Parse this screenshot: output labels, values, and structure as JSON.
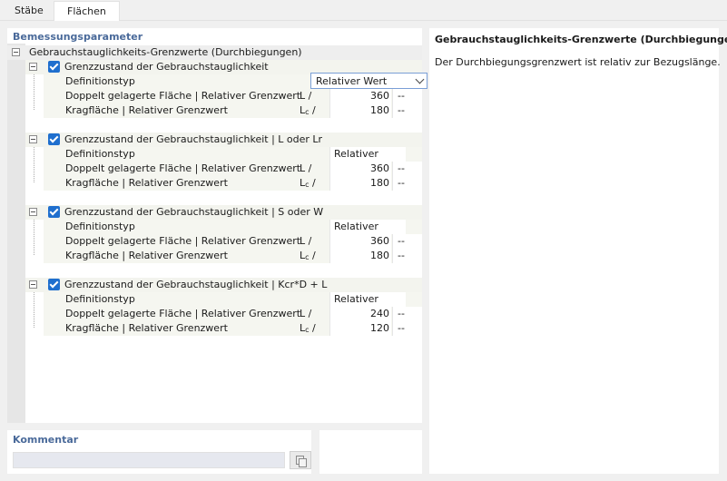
{
  "tabs": [
    {
      "label": "Stäbe",
      "active": false
    },
    {
      "label": "Flächen",
      "active": true
    }
  ],
  "params": {
    "section_title": "Bemessungsparameter",
    "root_label": "Gebrauchstauglichkeits-Grenzwerte (Durchbiegungen)",
    "groups": [
      {
        "label": "Grenzzustand der Gebrauchstauglichkeit",
        "checked": true,
        "definition_label": "Definitionstyp",
        "definition_value": "Relativer Wert",
        "definition_is_dropdown": true,
        "row1_label": "Doppelt gelagerte Fläche | Relativer Grenzwert",
        "row1_symbol": "L /",
        "row1_value": "360",
        "row1_unit": "--",
        "row2_label": "Kragfläche | Relativer Grenzwert",
        "row2_symbol_base": "L",
        "row2_symbol_sub": "c",
        "row2_symbol_tail": " /",
        "row2_value": "180",
        "row2_unit": "--"
      },
      {
        "label": "Grenzzustand der Gebrauchstauglichkeit | L oder Lr",
        "checked": true,
        "definition_label": "Definitionstyp",
        "definition_value": "Relativer Wert",
        "definition_is_dropdown": false,
        "row1_label": "Doppelt gelagerte Fläche | Relativer Grenzwert",
        "row1_symbol": "L /",
        "row1_value": "360",
        "row1_unit": "--",
        "row2_label": "Kragfläche | Relativer Grenzwert",
        "row2_symbol_base": "L",
        "row2_symbol_sub": "c",
        "row2_symbol_tail": " /",
        "row2_value": "180",
        "row2_unit": "--"
      },
      {
        "label": "Grenzzustand der Gebrauchstauglichkeit | S oder W",
        "checked": true,
        "definition_label": "Definitionstyp",
        "definition_value": "Relativer Wert",
        "definition_is_dropdown": false,
        "row1_label": "Doppelt gelagerte Fläche | Relativer Grenzwert",
        "row1_symbol": "L /",
        "row1_value": "360",
        "row1_unit": "--",
        "row2_label": "Kragfläche | Relativer Grenzwert",
        "row2_symbol_base": "L",
        "row2_symbol_sub": "c",
        "row2_symbol_tail": " /",
        "row2_value": "180",
        "row2_unit": "--"
      },
      {
        "label": "Grenzzustand der Gebrauchstauglichkeit | Kcr*D + L",
        "checked": true,
        "definition_label": "Definitionstyp",
        "definition_value": "Relativer Wert",
        "definition_is_dropdown": false,
        "row1_label": "Doppelt gelagerte Fläche | Relativer Grenzwert",
        "row1_symbol": "L /",
        "row1_value": "240",
        "row1_unit": "--",
        "row2_label": "Kragfläche | Relativer Grenzwert",
        "row2_symbol_base": "L",
        "row2_symbol_sub": "c",
        "row2_symbol_tail": " /",
        "row2_value": "120",
        "row2_unit": "--"
      }
    ]
  },
  "info": {
    "title": "Gebrauchstauglichkeits-Grenzwerte (Durchbiegungen)",
    "text": "Der Durchbiegungsgrenzwert ist relativ zur Bezugslänge."
  },
  "comment": {
    "title": "Kommentar",
    "value": ""
  },
  "icons": {
    "collapse": "minus-box-icon",
    "check": "checkbox-checked-icon",
    "dropdown": "chevron-down-icon",
    "copy": "copy-icon"
  },
  "colors": {
    "accent": "#1f6fce",
    "section_header": "#4a6a9a",
    "dropdown_border": "#7a9fd6"
  }
}
